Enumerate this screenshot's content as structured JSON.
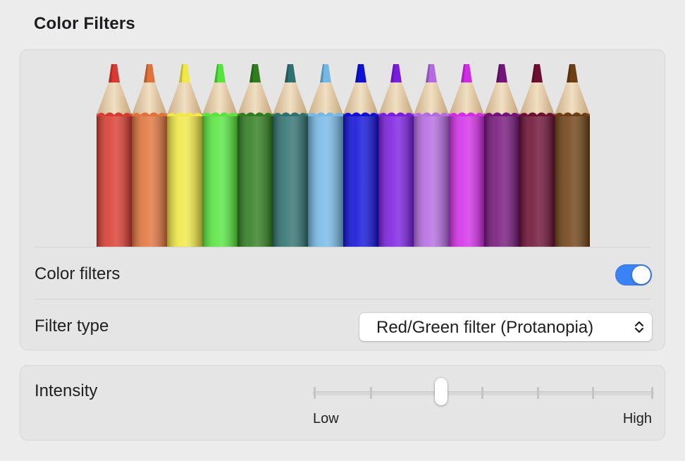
{
  "section": {
    "title": "Color Filters"
  },
  "preview": {
    "pencil_colors": [
      "#d93a30",
      "#e0733a",
      "#f0e844",
      "#55e53c",
      "#2e7d1e",
      "#2f7070",
      "#74b8e6",
      "#0f10d8",
      "#7a1de0",
      "#b46ae0",
      "#d22ce6",
      "#74147a",
      "#6c0f32",
      "#6e3f14"
    ]
  },
  "color_filters": {
    "label": "Color filters",
    "enabled": true,
    "accent": "#3b82f6"
  },
  "filter_type": {
    "label": "Filter type",
    "value": "Red/Green filter (Protanopia)"
  },
  "intensity": {
    "label": "Intensity",
    "low_label": "Low",
    "high_label": "High",
    "value": 0.375
  }
}
